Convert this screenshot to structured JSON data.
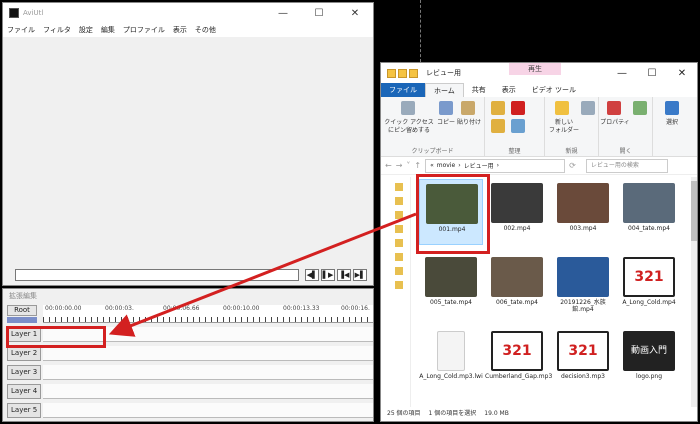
{
  "aviutl": {
    "title": "AviUtl",
    "menu": [
      "ファイル",
      "フィルタ",
      "設定",
      "編集",
      "プロファイル",
      "表示",
      "その他"
    ],
    "controls": [
      "◀▌",
      "▌▶",
      "▐◀",
      "▶▌"
    ]
  },
  "timeline": {
    "title": "拡張編集",
    "root_label": "Root",
    "ruler": [
      "00:00:00.00",
      "00:00:03.",
      "00:00:06.66",
      "00:00:10.00",
      "00:00:13.33",
      "00:00:16."
    ],
    "layers": [
      "Layer 1",
      "Layer 2",
      "Layer 3",
      "Layer 4",
      "Layer 5"
    ]
  },
  "explorer": {
    "title": "レビュー用",
    "context_tab": "再生",
    "tabs": [
      "ファイル",
      "ホーム",
      "共有",
      "表示",
      "ビデオ ツール"
    ],
    "ribbon": {
      "clipboard": {
        "pin": "クイック アクセス\nにピン留めする",
        "copy": "コピー",
        "paste": "貼り付け",
        "group": "クリップボード"
      },
      "organize": {
        "group": "整理"
      },
      "new": {
        "folder": "新しい\nフォルダー",
        "group": "新規"
      },
      "open": {
        "properties": "プロパティ",
        "group": "開く"
      },
      "select": {
        "label": "選択"
      }
    },
    "breadcrumb": [
      "«",
      "movie",
      "›",
      "レビュー用",
      "›"
    ],
    "search_placeholder": "レビュー用の検索",
    "files": [
      {
        "name": "001.mp4",
        "selected": true,
        "color": "#4a5a3a"
      },
      {
        "name": "002.mp4",
        "color": "#3a3a3a"
      },
      {
        "name": "003.mp4",
        "color": "#6a4a3a"
      },
      {
        "name": "004_tate.mp4",
        "color": "#5a6a7a"
      },
      {
        "name": "005_tate.mp4",
        "color": "#4a4a3a"
      },
      {
        "name": "006_tate.mp4",
        "color": "#6a5a4a"
      },
      {
        "name": "20191226_水族館.mp4",
        "color": "#2a5a9a"
      },
      {
        "name": "A_Long_Cold.mp4",
        "color": "vlc"
      },
      {
        "name": "A_Long_Cold.mp3.lwi",
        "color": "doc"
      },
      {
        "name": "Cumberland_Gap.mp3",
        "color": "vlc"
      },
      {
        "name": "decision3.mp3",
        "color": "vlc"
      },
      {
        "name": "logo.png",
        "color": "logo"
      }
    ],
    "status": {
      "count": "25 個の項目",
      "selected": "1 個の項目を選択",
      "size": "19.0 MB"
    }
  },
  "logo_text": "動画入門",
  "vlc_text": "321"
}
